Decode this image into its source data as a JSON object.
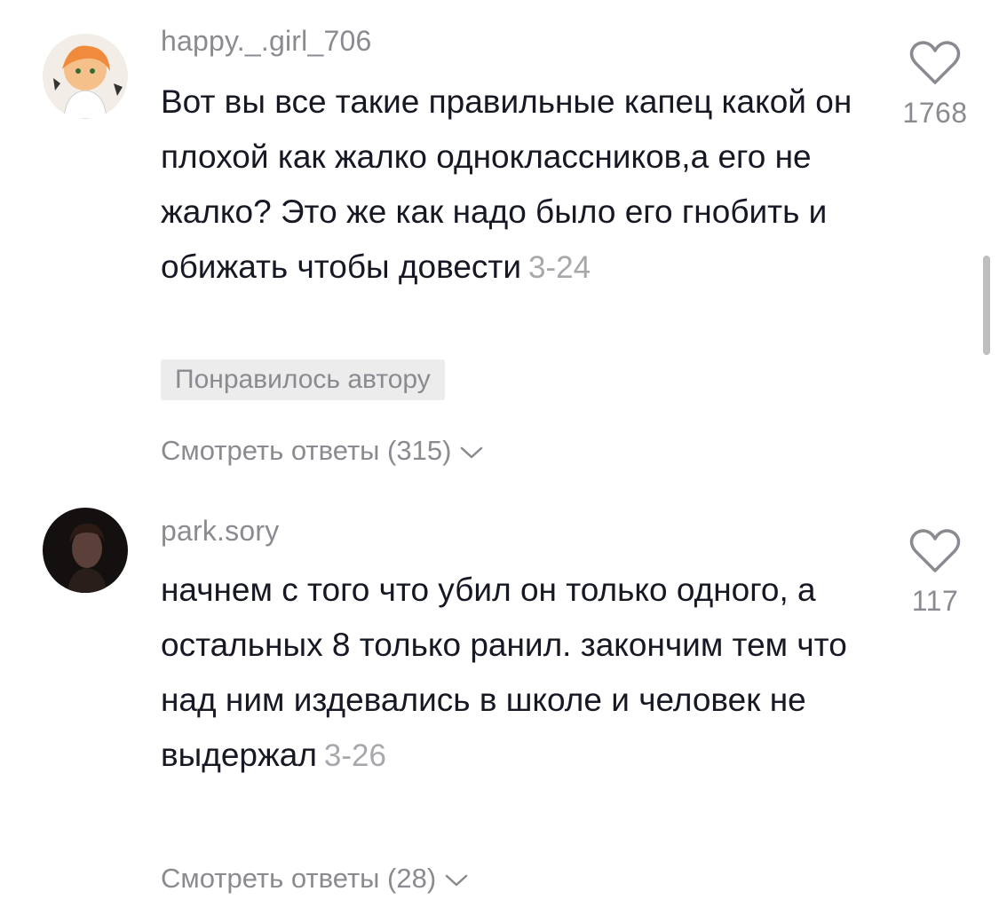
{
  "comments": [
    {
      "username": "happy._.girl_706",
      "text": "Вот вы все такие правильные капец какой он плохой как жалко одноклассников,а его не жалко? Это же как надо было его гнобить и обижать чтобы довести",
      "date": "3-24",
      "likes": "1768",
      "author_badge": "Понравилось автору",
      "replies_label": "Смотреть ответы (315)",
      "avatar_icon": "anime-girl-avatar",
      "heart_icon": "heart-outline-icon"
    },
    {
      "username": "park.sory",
      "text": "начнем с того что убил он только одного, а остальных 8 только ранил. закончим тем что над ним издевались в школе и человек не выдержал",
      "date": "3-26",
      "likes": "117",
      "replies_label": "Смотреть ответы (28)",
      "avatar_icon": "dark-portrait-avatar",
      "heart_icon": "heart-outline-icon"
    }
  ],
  "colors": {
    "text": "#161823",
    "muted": "#8a8b91",
    "badge_bg": "#ececec"
  }
}
